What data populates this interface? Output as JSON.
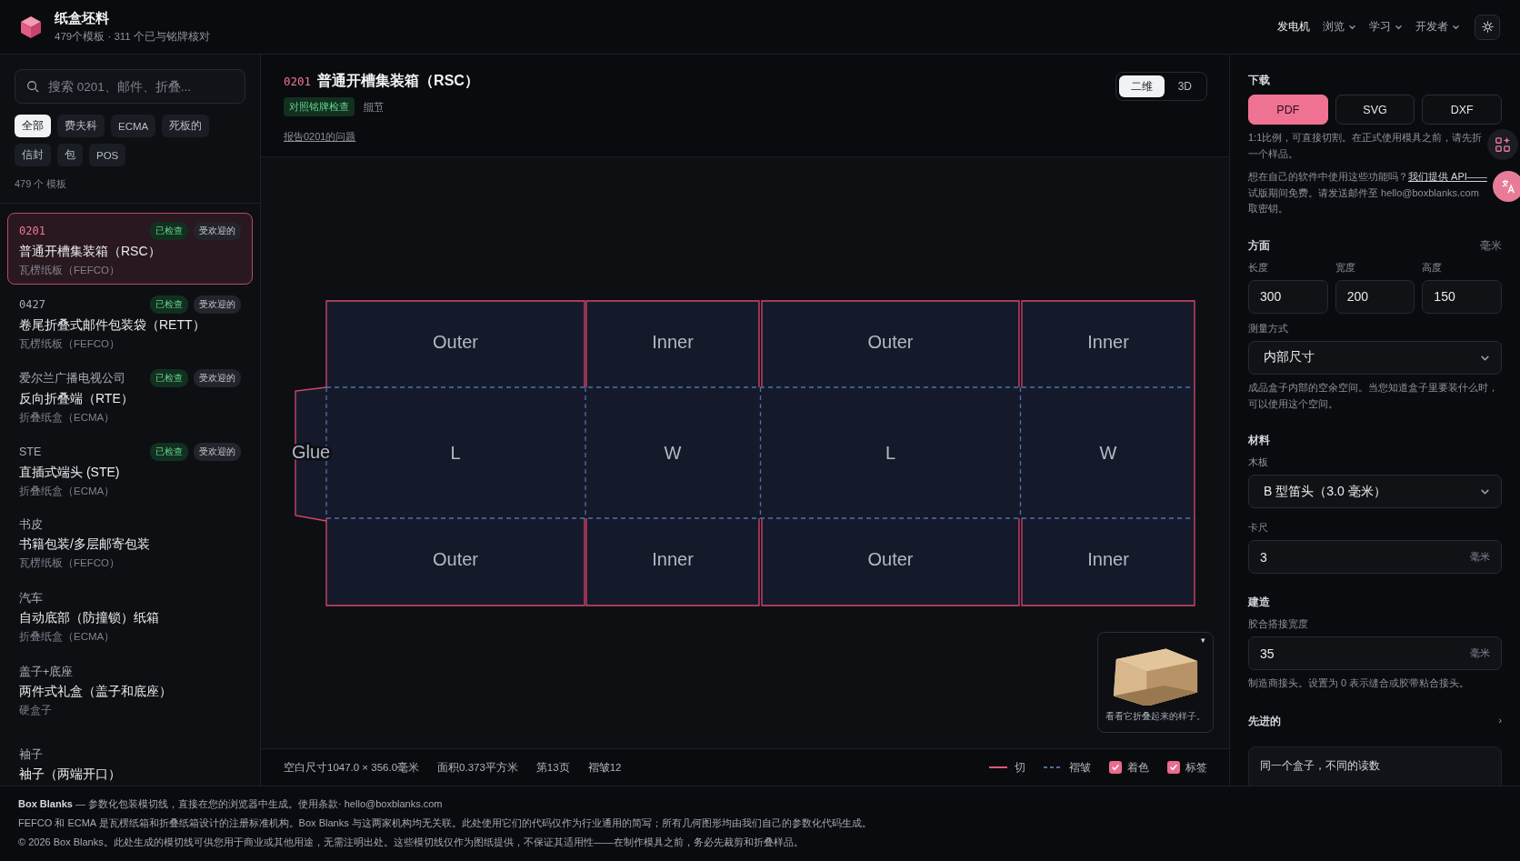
{
  "app": {
    "title": "纸盒坯料",
    "subtitle": "479个模板 · 311 个已与铭牌核对"
  },
  "nav": [
    {
      "label": "发电机",
      "selected": true,
      "dropdown": false
    },
    {
      "label": "浏览",
      "selected": false,
      "dropdown": true
    },
    {
      "label": "学习",
      "selected": false,
      "dropdown": true
    },
    {
      "label": "开发者",
      "selected": false,
      "dropdown": true
    }
  ],
  "sidebar": {
    "search": {
      "placeholder": "搜索 0201、邮件、折叠..."
    },
    "filters": [
      {
        "label": "全部",
        "selected": true
      },
      {
        "label": "费夫科",
        "selected": false
      },
      {
        "label": "ECMA",
        "selected": false
      },
      {
        "label": "死板的",
        "selected": false
      },
      {
        "label": "信封",
        "selected": false
      },
      {
        "label": "包",
        "selected": false
      },
      {
        "label": "POS",
        "selected": false
      }
    ],
    "count": "479 个 模板",
    "templates": [
      {
        "code": "0201",
        "kind": "code",
        "name": "普通开槽集装箱（RSC）",
        "category": "瓦楞纸板（FEFCO）",
        "selected": true,
        "badges": [
          {
            "label": "已检查",
            "kind": "checked"
          },
          {
            "label": "受欢迎的",
            "kind": "popular"
          }
        ]
      },
      {
        "code": "0427",
        "kind": "code",
        "name": "卷尾折叠式邮件包装袋（RETT）",
        "category": "瓦楞纸板（FEFCO）",
        "selected": false,
        "badges": [
          {
            "label": "已检查",
            "kind": "checked"
          },
          {
            "label": "受欢迎的",
            "kind": "popular"
          }
        ]
      },
      {
        "code": "爱尔兰广播电视公司",
        "kind": "alias",
        "name": "反向折叠端（RTE）",
        "category": "折叠纸盒（ECMA）",
        "selected": false,
        "badges": [
          {
            "label": "已检查",
            "kind": "checked"
          },
          {
            "label": "受欢迎的",
            "kind": "popular"
          }
        ]
      },
      {
        "code": "STE",
        "kind": "alias",
        "name": "直插式端头 (STE)",
        "category": "折叠纸盒（ECMA）",
        "selected": false,
        "badges": [
          {
            "label": "已检查",
            "kind": "checked"
          },
          {
            "label": "受欢迎的",
            "kind": "popular"
          }
        ]
      },
      {
        "code": "书皮",
        "kind": "alias",
        "name": "书籍包装/多层邮寄包装",
        "category": "瓦楞纸板（FEFCO）",
        "selected": false
      },
      {
        "code": "汽车",
        "kind": "alias",
        "name": "自动底部（防撞锁）纸箱",
        "category": "折叠纸盒（ECMA）",
        "selected": false
      },
      {
        "code": "盖子+底座",
        "kind": "alias",
        "name": "两件式礼盒（盖子和底座）",
        "category": "硬盒子",
        "selected": false
      },
      {
        "code": "袖子",
        "kind": "alias",
        "name": "袖子（两端开口）",
        "selected": false
      }
    ]
  },
  "workspace": {
    "code": "0201",
    "title": "普通开槽集装箱（RSC）",
    "verified": "对照铭牌检查",
    "details_link": "细节",
    "report_link": "报告0201的问题",
    "views": [
      {
        "label": "二维",
        "selected": true
      },
      {
        "label": "3D",
        "selected": false
      }
    ],
    "dieline": {
      "glue_label": "Glue",
      "columns": [
        {
          "top": "Outer",
          "middle": "L",
          "bottom": "Outer"
        },
        {
          "top": "Inner",
          "middle": "W",
          "bottom": "Inner"
        },
        {
          "top": "Outer",
          "middle": "L",
          "bottom": "Outer"
        },
        {
          "top": "Inner",
          "middle": "W",
          "bottom": "Inner"
        }
      ]
    },
    "preview": {
      "toggle": "▾",
      "caption": "看看它折叠起来的样子。"
    },
    "stats": [
      "空白尺寸1047.0 × 356.0毫米",
      "面积0.373平方米",
      "第13页",
      "褶皱12"
    ],
    "legend": [
      {
        "kind": "cut",
        "label": "切"
      },
      {
        "kind": "fold",
        "label": "褶皱"
      }
    ],
    "shading": {
      "label": "着色",
      "checked": true
    },
    "labels": {
      "label": "标签",
      "checked": true
    }
  },
  "settings": {
    "download": {
      "heading": "下载",
      "formats": [
        {
          "label": "PDF",
          "selected": true
        },
        {
          "label": "SVG",
          "selected": false
        },
        {
          "label": "DXF",
          "selected": false
        }
      ],
      "note_lines": [
        "1:1比例，可直接切割。在正式使用模具之前，请先折",
        "一个样品。"
      ],
      "api_before": "想在自己的软件中使用这些功能吗？",
      "api_link": "我们提供 API——",
      "api_after": [
        "试版期间免费。请发送邮件至 hello@boxblanks.com",
        "取密钥。"
      ]
    },
    "dimensions": {
      "heading": "方面",
      "unit": "毫米",
      "fields": [
        {
          "label": "长度",
          "value": "300"
        },
        {
          "label": "宽度",
          "value": "200"
        },
        {
          "label": "高度",
          "value": "150"
        }
      ],
      "measure": {
        "label": "测量方式",
        "value": "内部尺寸",
        "hint": "成品盒子内部的空余空间。当您知道盒子里要装什么时，可以使用这个空间。"
      }
    },
    "material": {
      "heading": "材料",
      "board": {
        "label": "木板",
        "value": "B 型笛头（3.0 毫米）"
      },
      "caliper": {
        "label": "卡尺",
        "value": "3",
        "unit": "毫米"
      }
    },
    "build": {
      "heading": "建造",
      "glue": {
        "label": "胶合搭接宽度",
        "value": "35",
        "unit": "毫米",
        "hint": "制造商接头。设置为 0 表示缝合或胶带粘合接头。"
      }
    },
    "advanced": {
      "label": "先进的",
      "expanded": false,
      "chevron": "›"
    },
    "card": "同一个盒子，不同的读数"
  },
  "footer": [
    "**Box Blanks** — 参数化包装模切线，直接在您的浏览器中生成。使用条款· hello@boxblanks.com",
    "FEFCO 和 ECMA 是瓦楞纸箱和折叠纸箱设计的注册标准机构。Box Blanks 与这两家机构均无关联。此处使用它们的代码仅作为行业通用的简写；所有几何图形均由我们自己的参数化代码生成。",
    "© 2026 Box Blanks。此处生成的模切线可供您用于商业或其他用途，无需注明出处。这些模切线仅作为图纸提供，不保证其适用性——在制作模具之前，务必先裁剪和折叠样品。"
  ]
}
